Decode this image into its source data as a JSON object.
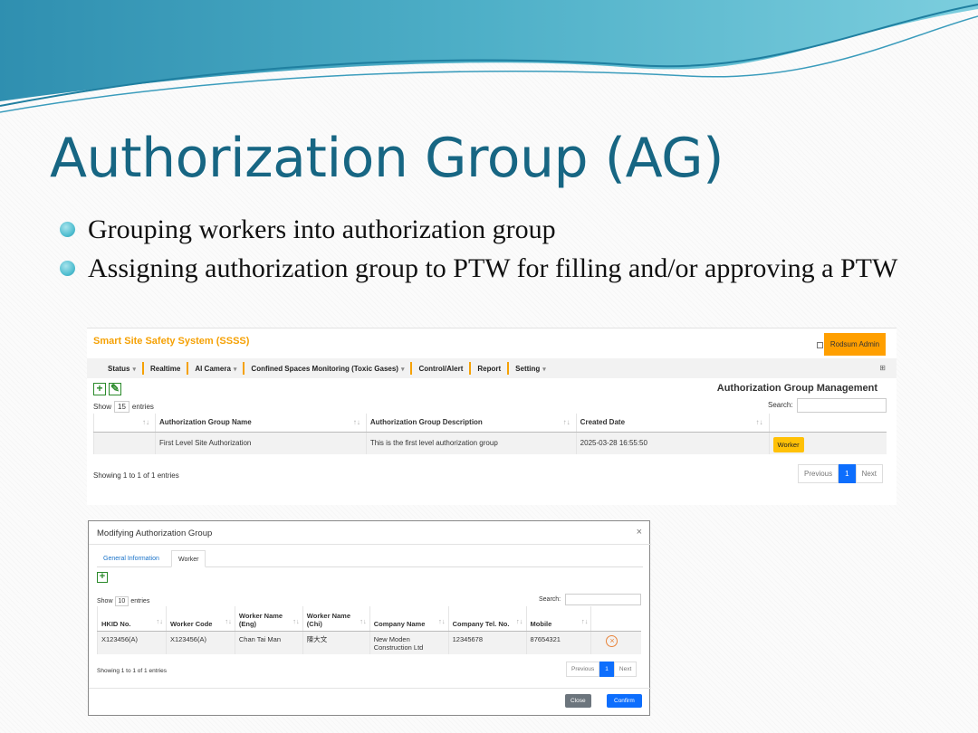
{
  "slide": {
    "title": "Authorization Group (AG)",
    "bullets": [
      "Grouping workers into authorization group",
      "Assigning authorization group to PTW for filling and/or approving a PTW"
    ],
    "colors": {
      "title": "#176683",
      "accent": "#f5a105",
      "primary": "#0d6efd"
    }
  },
  "app": {
    "brand": "Smart Site Safety System (SSSS)",
    "user_button": "Rodsum Admin",
    "nav": [
      {
        "label": "Status",
        "dropdown": true
      },
      {
        "label": "Realtime",
        "dropdown": false
      },
      {
        "label": "AI Camera",
        "dropdown": true
      },
      {
        "label": "Confined Spaces Monitoring (Toxic Gases)",
        "dropdown": true
      },
      {
        "label": "Control/Alert",
        "dropdown": false
      },
      {
        "label": "Report",
        "dropdown": false
      },
      {
        "label": "Setting",
        "dropdown": true
      }
    ],
    "page_heading": "Authorization Group Management",
    "show_prefix": "Show",
    "page_length": "15",
    "show_suffix": "entries",
    "search_label": "Search:",
    "columns": [
      "Authorization Group Name",
      "Authorization Group Description",
      "Created Date"
    ],
    "rows": [
      {
        "name": "First Level Site Authorization",
        "description": "This is the first level authorization group",
        "created": "2025-03-28 16:55:50",
        "action": "Worker"
      }
    ],
    "info": "Showing 1 to 1 of 1 entries",
    "pager": {
      "prev": "Previous",
      "page": "1",
      "next": "Next"
    }
  },
  "modal": {
    "title": "Modifying Authorization Group",
    "close_glyph": "×",
    "tabs": [
      "General Information",
      "Worker"
    ],
    "show_prefix": "Show",
    "page_length": "10",
    "show_suffix": "entries",
    "search_label": "Search:",
    "columns": [
      "HKID No.",
      "Worker Code",
      "Worker Name (Eng)",
      "Worker Name (Chi)",
      "Company Name",
      "Company Tel. No.",
      "Mobile"
    ],
    "rows": [
      {
        "hkid": "X123456(A)",
        "code": "X123456(A)",
        "name_eng": "Chan Tai Man",
        "name_chi": "陳大文",
        "company": "New Moden Construction Ltd",
        "tel": "12345678",
        "mobile": "87654321"
      }
    ],
    "info": "Showing 1 to 1 of 1 entries",
    "pager": {
      "prev": "Previous",
      "page": "1",
      "next": "Next"
    },
    "close_label": "Close",
    "confirm_label": "Confirm"
  }
}
